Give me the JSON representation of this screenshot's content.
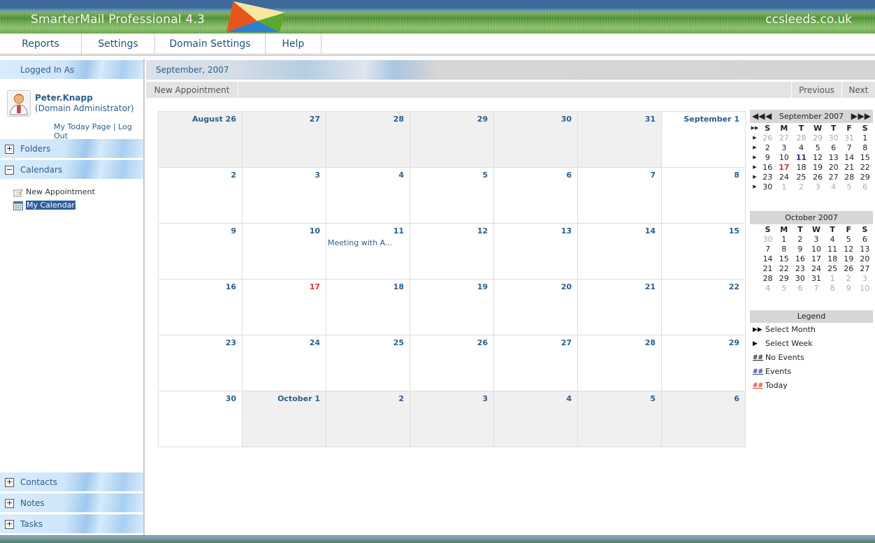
{
  "app": {
    "title": "SmarterMail Professional 4.3",
    "site": "ccsleeds.co.uk"
  },
  "menu": [
    "Reports",
    "Settings",
    "Domain Settings",
    "Help"
  ],
  "sidebar": {
    "logged_in_label": "Logged In As",
    "user_name": "Peter.Knapp",
    "user_role": "(Domain Administrator)",
    "today_link": "My Today Page",
    "separator": "|",
    "logout_link": "Log Out",
    "sections": {
      "folders": "Folders",
      "calendars": "Calendars",
      "contacts": "Contacts",
      "notes": "Notes",
      "tasks": "Tasks"
    },
    "calendar_items": {
      "new_appointment": "New Appointment",
      "my_calendar": "My Calendar"
    },
    "plus": "+",
    "minus": "−"
  },
  "calendar": {
    "month_title": "September, 2007",
    "toolbar": {
      "new_appointment": "New Appointment",
      "previous": "Previous",
      "next": "Next"
    },
    "weeks": [
      [
        {
          "d": "August 26",
          "o": true
        },
        {
          "d": "27",
          "o": true
        },
        {
          "d": "28",
          "o": true
        },
        {
          "d": "29",
          "o": true
        },
        {
          "d": "30",
          "o": true
        },
        {
          "d": "31",
          "o": true
        },
        {
          "d": "September 1"
        }
      ],
      [
        {
          "d": "2"
        },
        {
          "d": "3"
        },
        {
          "d": "4"
        },
        {
          "d": "5"
        },
        {
          "d": "6"
        },
        {
          "d": "7"
        },
        {
          "d": "8"
        }
      ],
      [
        {
          "d": "9"
        },
        {
          "d": "10"
        },
        {
          "d": "11",
          "event": "Meeting with A..."
        },
        {
          "d": "12"
        },
        {
          "d": "13"
        },
        {
          "d": "14"
        },
        {
          "d": "15"
        }
      ],
      [
        {
          "d": "16"
        },
        {
          "d": "17",
          "today": true
        },
        {
          "d": "18"
        },
        {
          "d": "19"
        },
        {
          "d": "20"
        },
        {
          "d": "21"
        },
        {
          "d": "22"
        }
      ],
      [
        {
          "d": "23"
        },
        {
          "d": "24"
        },
        {
          "d": "25"
        },
        {
          "d": "26"
        },
        {
          "d": "27"
        },
        {
          "d": "28"
        },
        {
          "d": "29"
        }
      ],
      [
        {
          "d": "30"
        },
        {
          "d": "October 1",
          "o": true
        },
        {
          "d": "2",
          "o": true
        },
        {
          "d": "3",
          "o": true
        },
        {
          "d": "4",
          "o": true
        },
        {
          "d": "5",
          "o": true
        },
        {
          "d": "6",
          "o": true
        }
      ]
    ]
  },
  "mini_september": {
    "title": "September 2007",
    "nav": {
      "first": "◀◀",
      "prev": "◀",
      "next": "▶",
      "last": "▶▶"
    },
    "week_selector": "▶",
    "month_selector": "▶▶",
    "days_header": [
      "S",
      "M",
      "T",
      "W",
      "T",
      "F",
      "S"
    ],
    "weeks": [
      [
        [
          "26",
          "o"
        ],
        [
          "27",
          "o"
        ],
        [
          "28",
          "o"
        ],
        [
          "29",
          "o"
        ],
        [
          "30",
          "o"
        ],
        [
          "31",
          "o"
        ],
        [
          "1",
          ""
        ]
      ],
      [
        [
          "2",
          ""
        ],
        [
          "3",
          ""
        ],
        [
          "4",
          ""
        ],
        [
          "5",
          ""
        ],
        [
          "6",
          ""
        ],
        [
          "7",
          ""
        ],
        [
          "8",
          ""
        ]
      ],
      [
        [
          "9",
          ""
        ],
        [
          "10",
          ""
        ],
        [
          "11",
          "ev"
        ],
        [
          "12",
          ""
        ],
        [
          "13",
          ""
        ],
        [
          "14",
          ""
        ],
        [
          "15",
          ""
        ]
      ],
      [
        [
          "16",
          ""
        ],
        [
          "17",
          "t"
        ],
        [
          "18",
          ""
        ],
        [
          "19",
          ""
        ],
        [
          "20",
          ""
        ],
        [
          "21",
          ""
        ],
        [
          "22",
          ""
        ]
      ],
      [
        [
          "23",
          ""
        ],
        [
          "24",
          ""
        ],
        [
          "25",
          ""
        ],
        [
          "26",
          ""
        ],
        [
          "27",
          ""
        ],
        [
          "28",
          ""
        ],
        [
          "29",
          ""
        ]
      ],
      [
        [
          "30",
          ""
        ],
        [
          "1",
          "o"
        ],
        [
          "2",
          "o"
        ],
        [
          "3",
          "o"
        ],
        [
          "4",
          "o"
        ],
        [
          "5",
          "o"
        ],
        [
          "6",
          "o"
        ]
      ]
    ]
  },
  "mini_october": {
    "title": "October 2007",
    "days_header": [
      "S",
      "M",
      "T",
      "W",
      "T",
      "F",
      "S"
    ],
    "weeks": [
      [
        [
          "30",
          "o"
        ],
        [
          "1",
          ""
        ],
        [
          "2",
          ""
        ],
        [
          "3",
          ""
        ],
        [
          "4",
          ""
        ],
        [
          "5",
          ""
        ],
        [
          "6",
          ""
        ]
      ],
      [
        [
          "7",
          ""
        ],
        [
          "8",
          ""
        ],
        [
          "9",
          ""
        ],
        [
          "10",
          ""
        ],
        [
          "11",
          ""
        ],
        [
          "12",
          ""
        ],
        [
          "13",
          ""
        ]
      ],
      [
        [
          "14",
          ""
        ],
        [
          "15",
          ""
        ],
        [
          "16",
          ""
        ],
        [
          "17",
          ""
        ],
        [
          "18",
          ""
        ],
        [
          "19",
          ""
        ],
        [
          "20",
          ""
        ]
      ],
      [
        [
          "21",
          ""
        ],
        [
          "22",
          ""
        ],
        [
          "23",
          ""
        ],
        [
          "24",
          ""
        ],
        [
          "25",
          ""
        ],
        [
          "26",
          ""
        ],
        [
          "27",
          ""
        ]
      ],
      [
        [
          "28",
          ""
        ],
        [
          "29",
          ""
        ],
        [
          "30",
          ""
        ],
        [
          "31",
          ""
        ],
        [
          "1",
          "o"
        ],
        [
          "2",
          "o"
        ],
        [
          "3",
          "o"
        ]
      ],
      [
        [
          "4",
          "o"
        ],
        [
          "5",
          "o"
        ],
        [
          "6",
          "o"
        ],
        [
          "7",
          "o"
        ],
        [
          "8",
          "o"
        ],
        [
          "9",
          "o"
        ],
        [
          "10",
          "o"
        ]
      ]
    ]
  },
  "legend": {
    "title": "Legend",
    "items": [
      {
        "symbol": "▶▶",
        "label": "Select Month",
        "color": "#000000"
      },
      {
        "symbol": "▶",
        "label": "Select Week",
        "color": "#000000"
      },
      {
        "symbol": "##",
        "label": "No Events",
        "color": "#222222"
      },
      {
        "symbol": "##",
        "label": "Events",
        "color": "#1e3b8c"
      },
      {
        "symbol": "##",
        "label": "Today",
        "color": "#dd3333"
      }
    ]
  }
}
